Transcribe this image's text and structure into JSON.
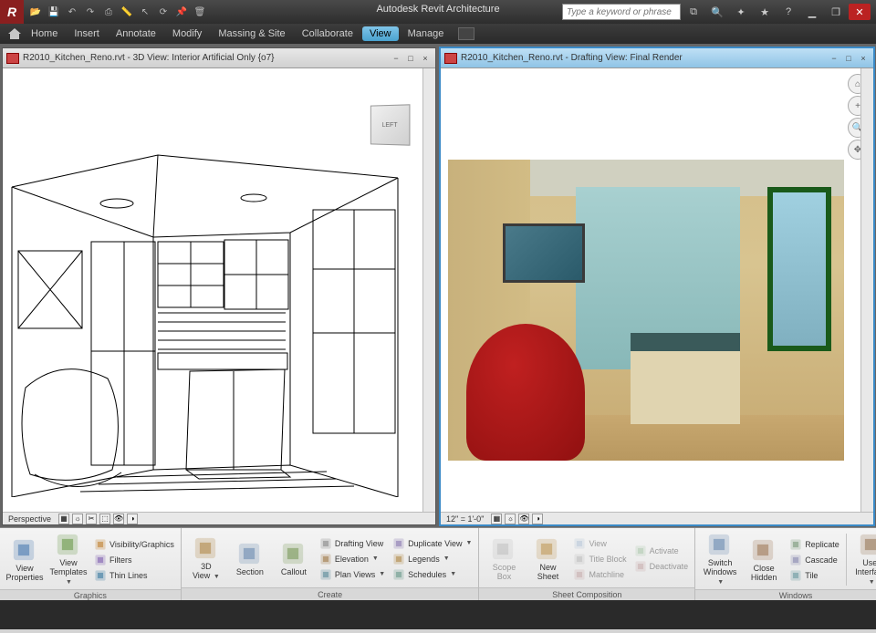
{
  "app": {
    "title": "Autodesk Revit Architecture",
    "search_placeholder": "Type a keyword or phrase"
  },
  "qat": {
    "items": [
      "open",
      "save",
      "undo",
      "redo",
      "print",
      "measure",
      "select",
      "sync",
      "unpin",
      "purge"
    ]
  },
  "menu": {
    "items": [
      "Home",
      "Insert",
      "Annotate",
      "Modify",
      "Massing & Site",
      "Collaborate",
      "View",
      "Manage"
    ],
    "active_index": 6
  },
  "views": {
    "left": {
      "title": "R2010_Kitchen_Reno.rvt - 3D View: Interior Artificial Only {o7}",
      "status": "Perspective",
      "cube_face": "LEFT"
    },
    "right": {
      "title": "R2010_Kitchen_Reno.rvt - Drafting View: Final Render",
      "status": "12\" = 1'-0\""
    }
  },
  "ribbon": {
    "panels": [
      {
        "name": "Graphics",
        "items": [
          {
            "kind": "big",
            "label": "View\nProperties",
            "icon": "view-properties"
          },
          {
            "kind": "big",
            "label": "View\nTemplates",
            "icon": "view-templates",
            "dropdown": true
          },
          {
            "kind": "small-col",
            "items": [
              {
                "label": "Visibility/Graphics",
                "icon": "vis-graphics"
              },
              {
                "label": "Filters",
                "icon": "filters"
              },
              {
                "label": "Thin Lines",
                "icon": "thin-lines"
              }
            ]
          }
        ]
      },
      {
        "name": "Create",
        "items": [
          {
            "kind": "big",
            "label": "3D\nView",
            "icon": "3d-view",
            "dropdown": true
          },
          {
            "kind": "big",
            "label": "Section",
            "icon": "section"
          },
          {
            "kind": "big",
            "label": "Callout",
            "icon": "callout"
          },
          {
            "kind": "small-col",
            "items": [
              {
                "label": "Drafting View",
                "icon": "drafting"
              },
              {
                "label": "Elevation",
                "icon": "elevation",
                "dropdown": true
              },
              {
                "label": "Plan Views",
                "icon": "plan-views",
                "dropdown": true
              }
            ]
          },
          {
            "kind": "small-col",
            "items": [
              {
                "label": "Duplicate View",
                "icon": "duplicate",
                "dropdown": true
              },
              {
                "label": "Legends",
                "icon": "legends",
                "dropdown": true
              },
              {
                "label": "Schedules",
                "icon": "schedules",
                "dropdown": true
              }
            ]
          }
        ]
      },
      {
        "name": "Sheet Composition",
        "items": [
          {
            "kind": "big",
            "label": "Scope\nBox",
            "icon": "scope-box",
            "disabled": true
          },
          {
            "kind": "big",
            "label": "New\nSheet",
            "icon": "new-sheet"
          },
          {
            "kind": "small-col",
            "items": [
              {
                "label": "View",
                "icon": "place-view",
                "disabled": true
              },
              {
                "label": "Title Block",
                "icon": "title-block",
                "disabled": true
              },
              {
                "label": "Matchline",
                "icon": "matchline",
                "disabled": true
              }
            ]
          },
          {
            "kind": "small-col",
            "items": [
              {
                "label": "Activate",
                "icon": "activate",
                "disabled": true
              },
              {
                "label": "Deactivate",
                "icon": "deactivate",
                "disabled": true
              }
            ]
          }
        ]
      },
      {
        "name": "Windows",
        "items": [
          {
            "kind": "big",
            "label": "Switch\nWindows",
            "icon": "switch-windows",
            "dropdown": true
          },
          {
            "kind": "big",
            "label": "Close\nHidden",
            "icon": "close-hidden"
          },
          {
            "kind": "small-col",
            "items": [
              {
                "label": "Replicate",
                "icon": "replicate"
              },
              {
                "label": "Cascade",
                "icon": "cascade"
              },
              {
                "label": "Tile",
                "icon": "tile"
              }
            ]
          },
          {
            "kind": "sep"
          },
          {
            "kind": "big",
            "label": "User\nInterface",
            "icon": "user-interface",
            "dropdown": true
          }
        ]
      }
    ]
  }
}
